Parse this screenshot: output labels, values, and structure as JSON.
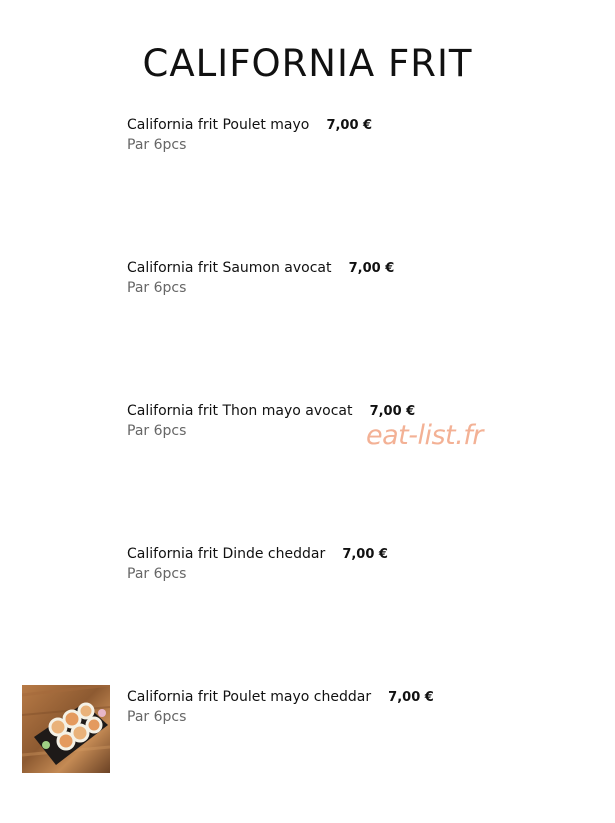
{
  "page": {
    "title": "CALIFORNIA FRIT"
  },
  "items": [
    {
      "name": "California frit Poulet mayo",
      "price": "7,00 €",
      "desc": "Par 6pcs"
    },
    {
      "name": "California frit Saumon avocat",
      "price": "7,00 €",
      "desc": "Par 6pcs"
    },
    {
      "name": "California frit Thon mayo avocat",
      "price": "7,00 €",
      "desc": "Par 6pcs"
    },
    {
      "name": "California frit Dinde cheddar",
      "price": "7,00 €",
      "desc": "Par 6pcs"
    },
    {
      "name": "California frit Poulet mayo cheddar",
      "price": "7,00 €",
      "desc": "Par 6pcs"
    }
  ],
  "watermark": "eat-list.fr",
  "colors": {
    "text": "#111111",
    "desc": "#666666",
    "watermark": "#f2a98a"
  },
  "images": {
    "item_5_thumb": "sushi-platter-photo"
  }
}
